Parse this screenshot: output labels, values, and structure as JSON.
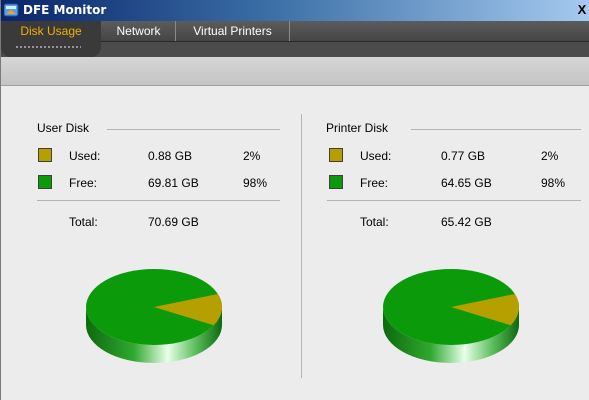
{
  "window": {
    "title": "DFE Monitor",
    "close_glyph": "X"
  },
  "tabs": [
    {
      "label": "Disk Usage",
      "active": true
    },
    {
      "label": "Network",
      "active": false
    },
    {
      "label": "Virtual Printers",
      "active": false
    }
  ],
  "user_disk": {
    "title": "User Disk",
    "used_label": "Used:",
    "used_value": "0.88 GB",
    "used_pct": "2%",
    "free_label": "Free:",
    "free_value": "69.81 GB",
    "free_pct": "98%",
    "total_label": "Total:",
    "total_value": "70.69 GB",
    "used_fraction": 0.0125
  },
  "printer_disk": {
    "title": "Printer Disk",
    "used_label": "Used:",
    "used_value": "0.77 GB",
    "used_pct": "2%",
    "free_label": "Free:",
    "free_value": "64.65 GB",
    "free_pct": "98%",
    "total_label": "Total:",
    "total_value": "65.42 GB",
    "used_fraction": 0.0118
  },
  "colors": {
    "used": "#b6a000",
    "free": "#0a9a0a",
    "active_tab_text": "#f0b000"
  }
}
